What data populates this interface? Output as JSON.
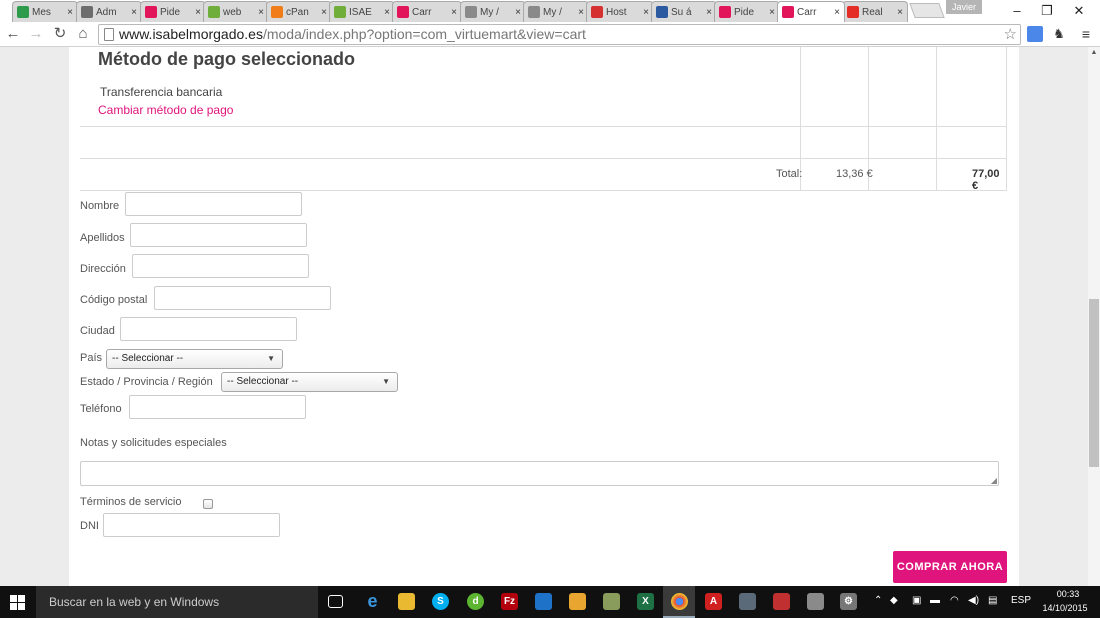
{
  "browser": {
    "tabs": [
      {
        "label": "Mes",
        "icon": "spreadsheet-icon",
        "color": "#2e9a4b"
      },
      {
        "label": "Adm",
        "icon": "admin-icon",
        "color": "#6d6d6d"
      },
      {
        "label": "Pide",
        "icon": "w-brand-icon",
        "color": "#e2145a"
      },
      {
        "label": "web",
        "icon": "joomla-icon",
        "color": "#6fae3a"
      },
      {
        "label": "cPan",
        "icon": "cpanel-icon",
        "color": "#f07d1a"
      },
      {
        "label": "ISAE",
        "icon": "joomla-icon",
        "color": "#6fae3a"
      },
      {
        "label": "Carr",
        "icon": "w-brand-icon",
        "color": "#e2145a"
      },
      {
        "label": "My /",
        "icon": "hosting-icon",
        "color": "#8a8a8a"
      },
      {
        "label": "My /",
        "icon": "hosting-icon",
        "color": "#8a8a8a"
      },
      {
        "label": "Host",
        "icon": "h-icon",
        "color": "#d63131"
      },
      {
        "label": "Su á",
        "icon": "wix-icon",
        "color": "#2c5aa0"
      },
      {
        "label": "Pide",
        "icon": "w-brand-icon",
        "color": "#e2145a"
      },
      {
        "label": "Carr",
        "icon": "w-brand-icon",
        "color": "#e2145a"
      },
      {
        "label": "Real",
        "icon": "youtube-icon",
        "color": "#e52d27"
      }
    ],
    "tab_close": "×",
    "profile_name": "Javier",
    "window_controls": {
      "minimize": "–",
      "maximize": "❐",
      "close": "✕"
    },
    "url_host": "www.isabelmorgado.es",
    "url_path": "/moda/index.php?option=com_virtuemart&view=cart",
    "star": "☆"
  },
  "cart": {
    "payment_title": "Método de pago seleccionado",
    "payment_method": "Transferencia bancaria",
    "change_payment": "Cambiar método de pago",
    "total_label": "Total:",
    "total_tax": "13,36 €",
    "total_amount": "77,00 €"
  },
  "form": {
    "nombre": "Nombre",
    "apellidos": "Apellidos",
    "direccion": "Dirección",
    "codigo_postal": "Código postal",
    "ciudad": "Ciudad",
    "pais": "País",
    "pais_select": "-- Seleccionar --",
    "estado": "Estado / Provincia / Región",
    "estado_select": "-- Seleccionar --",
    "telefono": "Teléfono",
    "notas": "Notas y solicitudes especiales",
    "terminos": "Términos de servicio",
    "dni": "DNI",
    "buy_button": "COMPRAR AHORA"
  },
  "taskbar": {
    "search_placeholder": "Buscar en la web y en Windows",
    "language": "ESP",
    "time": "00:33",
    "date": "14/10/2015"
  },
  "colors": {
    "accent": "#e0147d",
    "taskbar": "#101010"
  }
}
